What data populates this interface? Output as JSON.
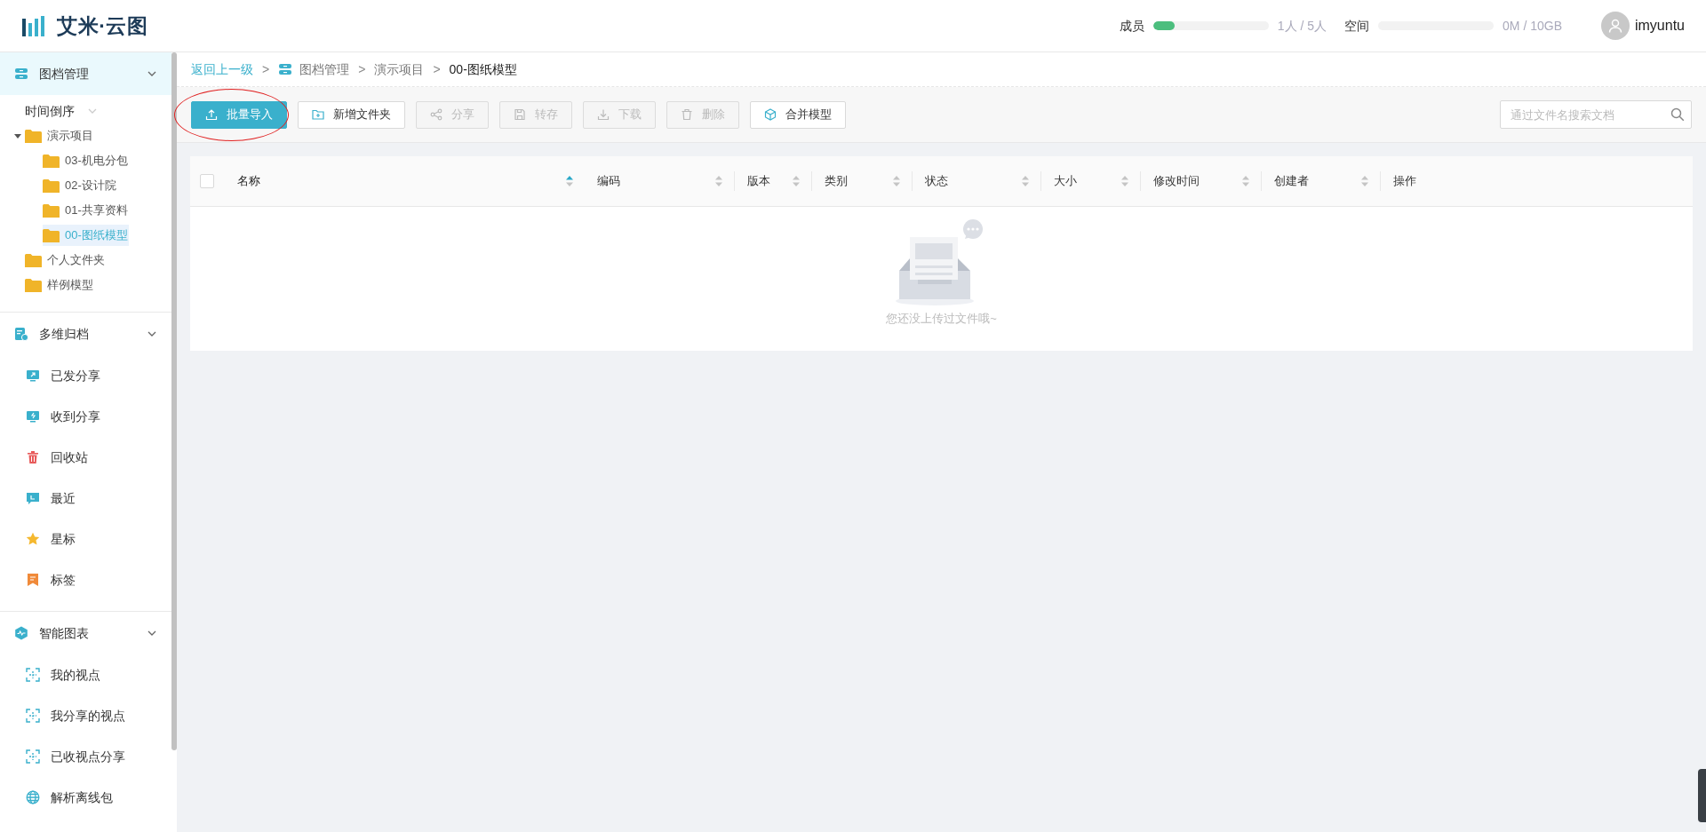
{
  "header": {
    "logo_text": "艾米·云图",
    "members": {
      "label": "成员",
      "level": 0.19,
      "reading": "1人 / 5人"
    },
    "storage": {
      "label": "空间",
      "level": 0,
      "reading": "0M / 10GB"
    },
    "user": {
      "name": "imyuntu"
    }
  },
  "sidebar": {
    "sections": [
      {
        "kind": "tree",
        "label": "图档管理",
        "expanded": true,
        "selected": true,
        "sort": {
          "label": "时间倒序"
        },
        "tree": [
          {
            "label": "演示项目",
            "expanded": true,
            "selected": false,
            "children": [
              {
                "label": "03-机电分包",
                "selected": false
              },
              {
                "label": "02-设计院",
                "selected": false
              },
              {
                "label": "01-共享资料",
                "selected": false
              },
              {
                "label": "00-图纸模型",
                "selected": true
              }
            ]
          },
          {
            "label": "个人文件夹",
            "selected": false
          },
          {
            "label": "样例模型",
            "selected": false
          }
        ]
      },
      {
        "kind": "list",
        "label": "多维归档",
        "expanded": true,
        "selected": false,
        "items": [
          {
            "label": "已发分享"
          },
          {
            "label": "收到分享"
          },
          {
            "label": "回收站"
          },
          {
            "label": "最近"
          },
          {
            "label": "星标"
          },
          {
            "label": "标签"
          }
        ]
      },
      {
        "kind": "list",
        "label": "智能图表",
        "expanded": true,
        "selected": false,
        "items": [
          {
            "label": "我的视点"
          },
          {
            "label": "我分享的视点"
          },
          {
            "label": "已收视点分享"
          },
          {
            "label": "解析离线包"
          }
        ]
      }
    ]
  },
  "breadcrumb": {
    "back": "返回上一级",
    "items": [
      {
        "separator": ">",
        "label": "图档管理",
        "icon": true
      },
      {
        "separator": ">",
        "label": "演示项目",
        "icon": false
      },
      {
        "separator": ">",
        "label": "00-图纸模型",
        "icon": false
      }
    ]
  },
  "toolbar": {
    "buttons": [
      {
        "label": "批量导入",
        "kind": "primary",
        "disabled": false,
        "circled": true
      },
      {
        "label": "新增文件夹",
        "kind": "default",
        "disabled": false,
        "circled": false
      },
      {
        "label": "分享",
        "kind": "default",
        "disabled": true,
        "circled": false
      },
      {
        "label": "转存",
        "kind": "default",
        "disabled": true,
        "circled": false
      },
      {
        "label": "下载",
        "kind": "default",
        "disabled": true,
        "circled": false
      },
      {
        "label": "删除",
        "kind": "default",
        "disabled": true,
        "circled": false
      },
      {
        "label": "合并模型",
        "kind": "default",
        "disabled": false,
        "circled": false
      }
    ],
    "search": {
      "placeholder": "通过文件名搜索文档"
    }
  },
  "table": {
    "select_all": {
      "checked": false
    },
    "columns": [
      {
        "label": "名称",
        "sortable": true,
        "sorted": true
      },
      {
        "label": "编码",
        "sortable": true,
        "sorted": false
      },
      {
        "label": "版本",
        "sortable": true,
        "sorted": false
      },
      {
        "label": "类别",
        "sortable": true,
        "sorted": false
      },
      {
        "label": "状态",
        "sortable": true,
        "sorted": false
      },
      {
        "label": "大小",
        "sortable": true,
        "sorted": false
      },
      {
        "label": "修改时间",
        "sortable": true,
        "sorted": false
      },
      {
        "label": "创建者",
        "sortable": true,
        "sorted": false
      },
      {
        "label": "操作",
        "sortable": false,
        "sorted": false
      }
    ],
    "empty_text": "您还没上传过文件哦~"
  }
}
